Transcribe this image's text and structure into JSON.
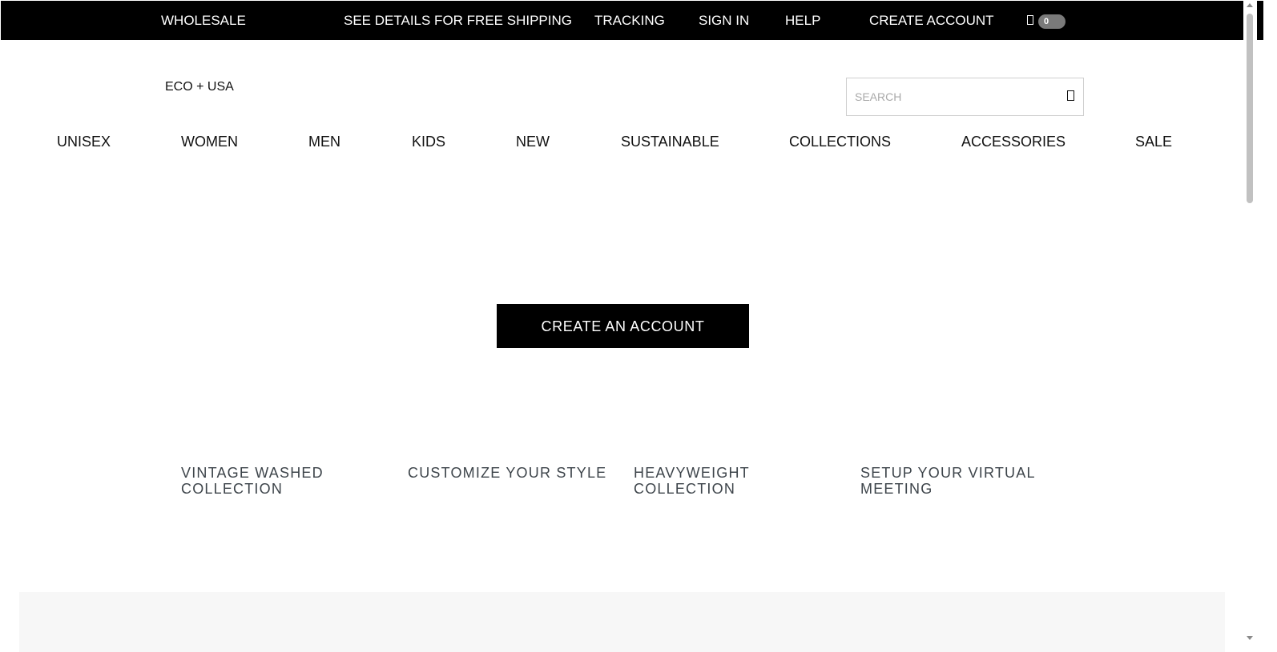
{
  "topbar": {
    "links": [
      "WHOLESALE",
      "SEE DETAILS FOR FREE SHIPPING",
      "TRACKING",
      "SIGN IN",
      "HELP",
      "CREATE ACCOUNT"
    ],
    "cart": {
      "icon": "shopping-bag-icon",
      "count": "0"
    }
  },
  "header": {
    "brand": "ECO + USA",
    "search": {
      "placeholder": "SEARCH",
      "value": "",
      "icon": "search-icon"
    }
  },
  "nav": {
    "items": [
      "UNISEX",
      "WOMEN",
      "MEN",
      "KIDS",
      "NEW",
      "SUSTAINABLE",
      "COLLECTIONS",
      "ACCESSORIES",
      "SALE"
    ]
  },
  "main": {
    "cta_label": "CREATE AN ACCOUNT"
  },
  "promos": [
    "VINTAGE WASHED COLLECTION",
    "CUSTOMIZE YOUR STYLE",
    "HEAVYWEIGHT COLLECTION",
    "SETUP YOUR VIRTUAL MEETING"
  ],
  "colors": {
    "topbar_bg": "#000000",
    "cta_bg": "#000000",
    "promo_text": "#3d444a",
    "footer_panel_bg": "#f7f7f7",
    "cart_badge_bg": "#7a7a7a"
  }
}
